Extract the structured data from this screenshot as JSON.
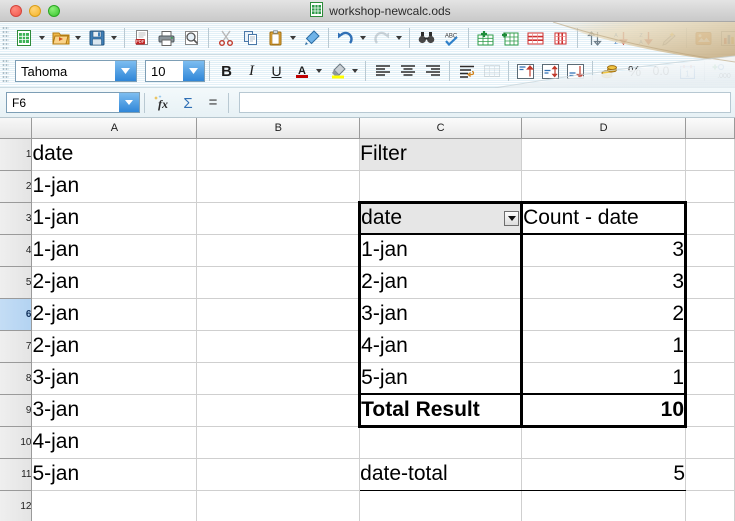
{
  "window": {
    "title": "workshop-newcalc.ods",
    "app_icon": "calc-document-icon",
    "controls": [
      "close-button",
      "minimize-button",
      "zoom-button"
    ]
  },
  "toolbar_main": {
    "items": [
      {
        "name": "new-document-button",
        "glyph": "🗎",
        "color": "#1f8a3b",
        "dropdown": true
      },
      {
        "name": "open-document-button",
        "glyph": "📂",
        "color": "#d98c16",
        "dropdown": true
      },
      {
        "name": "save-button",
        "glyph": "💾",
        "color": "#2b6ca3",
        "dropdown": true
      },
      {
        "name": "export-pdf-button",
        "glyph": "🗎",
        "color": "#b03030",
        "dropdown": false
      },
      {
        "name": "print-button",
        "glyph": "🖨",
        "color": "#4a4a4a",
        "dropdown": false
      },
      {
        "name": "print-preview-button",
        "glyph": "🔍",
        "color": "#5a5a5a",
        "dropdown": false
      },
      {
        "name": "cut-button",
        "glyph": "✂",
        "color": "#c0392b",
        "dropdown": false
      },
      {
        "name": "copy-button",
        "glyph": "⧉",
        "color": "#3b7dbd",
        "dropdown": false
      },
      {
        "name": "paste-button",
        "glyph": "📋",
        "color": "#c98f2e",
        "dropdown": true
      },
      {
        "name": "clone-formatting-button",
        "glyph": "🖌",
        "color": "#2f80c9",
        "dropdown": false
      },
      {
        "name": "undo-button",
        "glyph": "↶",
        "color": "#2f6fb5",
        "dropdown": true
      },
      {
        "name": "redo-button",
        "glyph": "↷",
        "color": "#9aa8b2",
        "dropdown": true,
        "disabled": true
      },
      {
        "name": "find-and-replace-button",
        "glyph": "🔭",
        "color": "#3a3a3a",
        "dropdown": false
      },
      {
        "name": "spelling-button",
        "glyph": "✓",
        "color": "#2f80c9",
        "dropdown": false
      },
      {
        "name": "insert-row-button",
        "glyph": "⊞",
        "color": "#2e9c4a",
        "dropdown": false
      },
      {
        "name": "insert-column-button",
        "glyph": "⊞",
        "color": "#2e9c4a",
        "dropdown": false
      },
      {
        "name": "delete-row-button",
        "glyph": "⊟",
        "color": "#cc2f2f",
        "dropdown": false
      },
      {
        "name": "delete-column-button",
        "glyph": "⊟",
        "color": "#cc2f2f",
        "dropdown": false
      },
      {
        "name": "sort-button",
        "glyph": "⇅",
        "color": "#6e7f8a",
        "dropdown": false
      },
      {
        "name": "sort-ascending-button",
        "glyph": "↓",
        "color": "#c0392b",
        "dropdown": false
      },
      {
        "name": "sort-descending-button",
        "glyph": "↓",
        "color": "#c0392b",
        "dropdown": false
      },
      {
        "name": "autofilter-button",
        "glyph": "✨",
        "color": "#d4a017",
        "dropdown": false
      },
      {
        "name": "insert-image-button",
        "glyph": "🖼",
        "color": "#d97b1e",
        "dropdown": false
      },
      {
        "name": "insert-chart-button",
        "glyph": "📊",
        "color": "#2f6fb5",
        "dropdown": false
      },
      {
        "name": "hyperlink-button",
        "glyph": "🔗",
        "color": "#d4541e",
        "dropdown": false
      },
      {
        "name": "special-character-button",
        "glyph": "⌘",
        "color": "#3b7dbd",
        "dropdown": false
      }
    ]
  },
  "toolbar_format": {
    "font_name": "Tahoma",
    "font_size": "10",
    "items": [
      {
        "name": "bold-button",
        "glyph": "B",
        "style": "bold"
      },
      {
        "name": "italic-button",
        "glyph": "I",
        "style": "italic"
      },
      {
        "name": "underline-button",
        "glyph": "U",
        "style": "underline"
      },
      {
        "name": "font-color-button",
        "glyph": "A",
        "color": "#000000",
        "swatch": "#c00000",
        "dropdown": true
      },
      {
        "name": "highlight-color-button",
        "glyph": "🎨",
        "swatch": "#ffff00",
        "dropdown": true
      },
      {
        "name": "align-left-button",
        "glyph": "☰"
      },
      {
        "name": "align-center-button",
        "glyph": "☰"
      },
      {
        "name": "align-right-button",
        "glyph": "☰"
      },
      {
        "name": "wrap-text-button",
        "glyph": "↵"
      },
      {
        "name": "merge-cells-button",
        "glyph": "⊞",
        "disabled": true
      },
      {
        "name": "align-top-button",
        "glyph": "↑",
        "color": "#c0392b"
      },
      {
        "name": "align-center-vertical-button",
        "glyph": "↕",
        "color": "#c0392b"
      },
      {
        "name": "align-bottom-button",
        "glyph": "↓",
        "color": "#c0392b"
      },
      {
        "name": "currency-format-button",
        "glyph": "🪙",
        "color": "#c8901a"
      },
      {
        "name": "percent-format-button",
        "glyph": "%",
        "color": "#3a3a3a"
      },
      {
        "name": "number-format-button",
        "glyph": "0.0",
        "color": "#3a3a3a"
      },
      {
        "name": "date-format-button",
        "glyph": "📅",
        "color": "#2f6fb5"
      },
      {
        "name": "add-decimal-button",
        "glyph": ".000",
        "color": "#2e9c4a"
      },
      {
        "name": "delete-decimal-button",
        "glyph": ".000",
        "color": "#cc2f2f"
      }
    ]
  },
  "formula_bar": {
    "name_box_value": "F6",
    "function_wizard": "fx",
    "sum_icon": "Σ",
    "equals_icon": "=",
    "input_line_value": ""
  },
  "sheet": {
    "column_headers": [
      "A",
      "B",
      "C",
      "D"
    ],
    "row_headers": [
      "1",
      "2",
      "3",
      "4",
      "5",
      "6",
      "7",
      "8",
      "9",
      "10",
      "11",
      "12"
    ],
    "selected_cell": "F6",
    "selected_row": "6",
    "rows": [
      {
        "r": "1",
        "A": "date",
        "B": "",
        "C": "Filter",
        "D": ""
      },
      {
        "r": "2",
        "A": "1-jan",
        "B": "",
        "C": "",
        "D": ""
      },
      {
        "r": "3",
        "A": "1-jan",
        "B": "",
        "C": "date",
        "D": "Count - date"
      },
      {
        "r": "4",
        "A": "1-jan",
        "B": "",
        "C": "1-jan",
        "D": "3"
      },
      {
        "r": "5",
        "A": "2-jan",
        "B": "",
        "C": "2-jan",
        "D": "3"
      },
      {
        "r": "6",
        "A": "2-jan",
        "B": "",
        "C": "3-jan",
        "D": "2"
      },
      {
        "r": "7",
        "A": "2-jan",
        "B": "",
        "C": "4-jan",
        "D": "1"
      },
      {
        "r": "8",
        "A": "3-jan",
        "B": "",
        "C": "5-jan",
        "D": "1"
      },
      {
        "r": "9",
        "A": "3-jan",
        "B": "",
        "C": "Total Result",
        "D": "10"
      },
      {
        "r": "10",
        "A": "4-jan",
        "B": "",
        "C": "",
        "D": ""
      },
      {
        "r": "11",
        "A": "5-jan",
        "B": "",
        "C": "date-total",
        "D": "5"
      },
      {
        "r": "12",
        "A": "",
        "B": "",
        "C": "",
        "D": ""
      }
    ]
  },
  "pivot_table": {
    "filter_label": "Filter",
    "row_field_label": "date",
    "value_field_label": "Count - date",
    "categories": [
      "1-jan",
      "2-jan",
      "3-jan",
      "4-jan",
      "5-jan"
    ],
    "counts": [
      "3",
      "3",
      "2",
      "1",
      "1"
    ],
    "total_label": "Total Result",
    "total_value": "10",
    "below_label": "date-total",
    "below_value": "5"
  },
  "colors": {
    "accent": "#2f86d8",
    "header_gray": "#e6e6e6",
    "selection_blue": "#b3d3f2",
    "grid_line": "#cfcfcf"
  }
}
